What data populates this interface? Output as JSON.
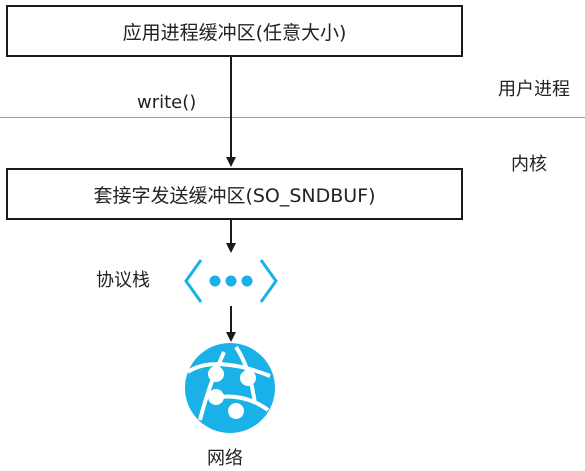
{
  "boxes": {
    "app_buffer": "应用进程缓冲区(任意大小)",
    "socket_send_buffer": "套接字发送缓冲区(SO_SNDBUF)"
  },
  "labels": {
    "write_call": "write()",
    "user_process": "用户进程",
    "kernel": "内核",
    "protocol_stack": "协议栈",
    "network": "网络"
  },
  "icons": {
    "protocol": "protocol-stack-icon",
    "network": "globe-network-icon"
  },
  "colors": {
    "icon_accent": "#1ab0e8",
    "line": "#1a1a1a",
    "divider": "#9a9a9a"
  }
}
